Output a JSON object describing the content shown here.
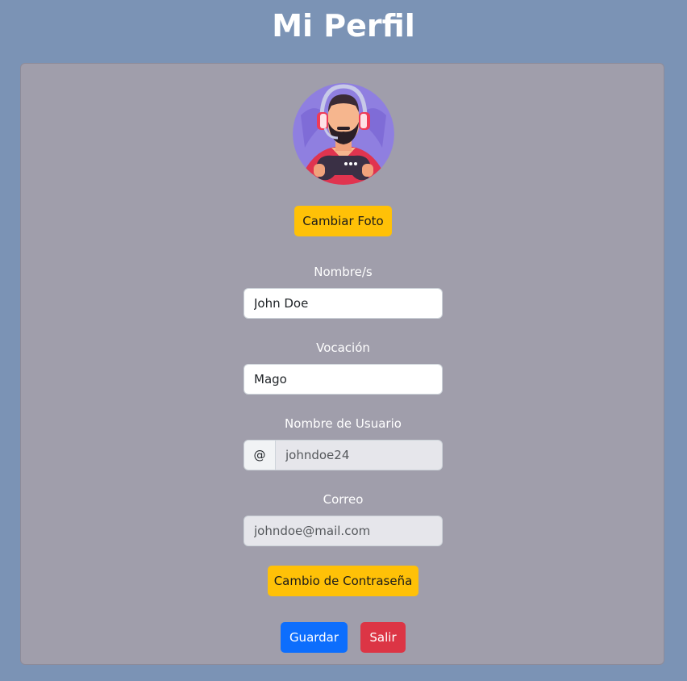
{
  "page": {
    "title": "Mi Perfil",
    "background_color": "#7b93b5",
    "card_color": "#a09eab"
  },
  "profile": {
    "avatar_icon": "avatar-gamer-headset-icon",
    "change_photo_label": "Cambiar Foto"
  },
  "form": {
    "name_label": "Nombre/s",
    "name_value": "John Doe",
    "vocation_label": "Vocación",
    "vocation_value": "Mago",
    "username_label": "Nombre de Usuario",
    "username_prefix": "@",
    "username_value": "johndoe24",
    "email_label": "Correo",
    "email_value": "johndoe@mail.com"
  },
  "actions": {
    "change_password_label": "Cambio de Contraseña",
    "save_label": "Guardar",
    "exit_label": "Salir"
  },
  "colors": {
    "warning": "#ffc107",
    "primary": "#0d6efd",
    "danger": "#dc3545"
  }
}
